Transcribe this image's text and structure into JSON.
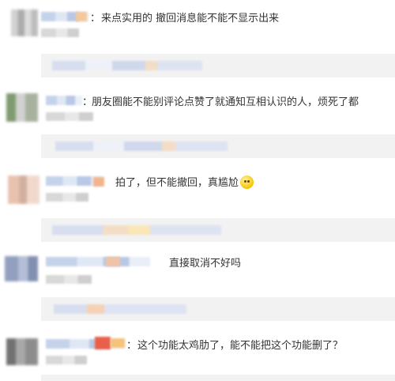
{
  "comments": [
    {
      "text": "来点实用的 撤回消息能不能不显示出来"
    },
    {
      "text": "朋友圈能不能别评论点赞了就通知互相认识的人，烦死了都"
    },
    {
      "text": "拍了，但不能撤回，真尴尬",
      "emoji": "smiling-face-emoji"
    },
    {
      "text": "直接取消不好吗"
    },
    {
      "text": "这个功能太鸡肋了，能不能把这个功能删了？"
    }
  ],
  "colon": "：",
  "colors": {
    "text": "#333333",
    "reply_bg": "#f2f2f2"
  }
}
